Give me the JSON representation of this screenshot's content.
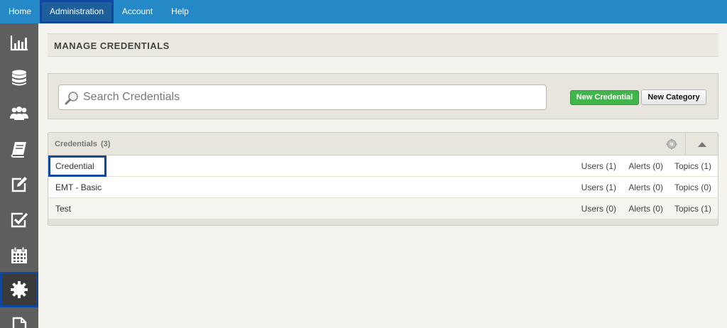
{
  "topnav": {
    "items": [
      {
        "label": "Home"
      },
      {
        "label": "Administration"
      },
      {
        "label": "Account"
      },
      {
        "label": "Help"
      }
    ]
  },
  "sidebar": {
    "icons": [
      "bar-chart-icon",
      "database-icon",
      "users-icon",
      "book-icon",
      "edit-icon",
      "checkbox-icon",
      "calendar-icon",
      "gear-icon",
      "document-icon"
    ],
    "active": "gear-icon"
  },
  "page": {
    "title": "MANAGE CREDENTIALS"
  },
  "search": {
    "placeholder": "Search Credentials",
    "value": ""
  },
  "actions": {
    "new_credential": "New Credential",
    "new_category": "New Category"
  },
  "credentials": {
    "title": "Credentials",
    "count": "(3)",
    "rows": [
      {
        "name": "Credential",
        "users": "Users (1)",
        "alerts": "Alerts (0)",
        "topics": "Topics (1)"
      },
      {
        "name": "EMT - Basic",
        "users": "Users (1)",
        "alerts": "Alerts (0)",
        "topics": "Topics (0)"
      },
      {
        "name": "Test",
        "users": "Users (0)",
        "alerts": "Alerts (0)",
        "topics": "Topics (1)"
      }
    ]
  },
  "colors": {
    "nav": "#2589c7",
    "sidebar": "#5e5e5e",
    "accent_green": "#3fb54a",
    "highlight": "#0f47a1"
  }
}
